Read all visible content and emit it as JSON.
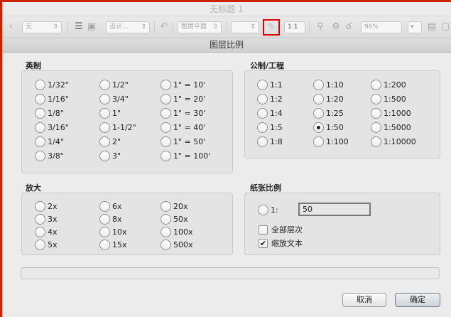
{
  "window": {
    "title": "无标题 1"
  },
  "toolbar": {
    "class_select": "无",
    "design_select": "设计...",
    "layer_select": "图层平面",
    "scale_field": "1:1",
    "zoom_field": "96%"
  },
  "dialog": {
    "title": "图层比例",
    "imperial": {
      "label": "英制",
      "options": [
        "1/32\"",
        "1/2\"",
        "1\" = 10'",
        "1/16\"",
        "3/4\"",
        "1\" = 20'",
        "1/8\"",
        "1\"",
        "1\" = 30'",
        "3/16\"",
        "1-1/2\"",
        "1\" = 40'",
        "1/4\"",
        "2\"",
        "1\" = 50'",
        "3/8\"",
        "3\"",
        "1\" = 100'"
      ]
    },
    "metric": {
      "label": "公制/工程",
      "options": [
        "1:1",
        "1:10",
        "1:200",
        "1:2",
        "1:20",
        "1:500",
        "1:4",
        "1:25",
        "1:1000",
        "1:5",
        "1:50",
        "1:5000",
        "1:8",
        "1:100",
        "1:10000"
      ],
      "selected": "1:50"
    },
    "enlarge": {
      "label": "放大",
      "options": [
        "2x",
        "6x",
        "20x",
        "3x",
        "8x",
        "50x",
        "4x",
        "10x",
        "100x",
        "5x",
        "15x",
        "500x"
      ]
    },
    "paper": {
      "label": "纸张比例",
      "radio_label": "1:",
      "value": "50",
      "all_layers_label": "全部层次",
      "all_layers_checked": false,
      "scale_text_label": "缩放文本",
      "scale_text_checked": true
    },
    "cancel_label": "取消",
    "ok_label": "确定"
  }
}
